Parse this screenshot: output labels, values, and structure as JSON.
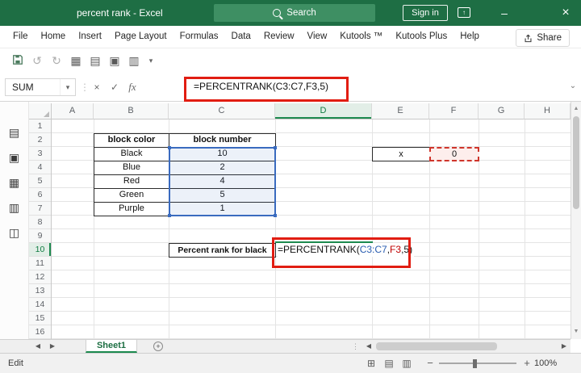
{
  "titlebar": {
    "title": "percent rank - Excel",
    "search_label": "Search",
    "signin_label": "Sign in"
  },
  "menu": {
    "items": [
      "File",
      "Home",
      "Insert",
      "Page Layout",
      "Formulas",
      "Data",
      "Review",
      "View",
      "Kutools ™",
      "Kutools Plus",
      "Help"
    ],
    "share_label": "Share"
  },
  "formula_bar": {
    "name_box": "SUM",
    "formula": "=PERCENTRANK(C3:C7,F3,5)"
  },
  "cell_formula": {
    "p1": "=PERCENTRANK(",
    "ref1": "C3:C7",
    "p2": ",",
    "ref2": "F3",
    "p3": ",5)"
  },
  "grid": {
    "columns": [
      "A",
      "B",
      "C",
      "D",
      "E",
      "F",
      "G",
      "H"
    ],
    "rows": [
      "1",
      "2",
      "3",
      "4",
      "5",
      "6",
      "7",
      "8",
      "9",
      "10",
      "11",
      "12",
      "13",
      "14",
      "15",
      "16"
    ]
  },
  "sheet": {
    "table": {
      "headers": [
        "block color",
        "block number"
      ],
      "rows": [
        [
          "Black",
          "10"
        ],
        [
          "Blue",
          "2"
        ],
        [
          "Red",
          "4"
        ],
        [
          "Green",
          "5"
        ],
        [
          "Purple",
          "1"
        ]
      ]
    },
    "x_label": "x",
    "x_value": "0",
    "result_label": "Percent rank for black"
  },
  "sheet_tabs": {
    "active": "Sheet1"
  },
  "status": {
    "mode": "Edit",
    "zoom": "100%"
  },
  "colors": {
    "accent_green": "#1e6e44",
    "annotation_red": "#e11d12",
    "ref_blue": "#2a5db0",
    "ref_red": "#c00000",
    "range_blue": "#3a6bbf"
  },
  "icons": {
    "minimize": "–",
    "close": "×",
    "up_small": "↑",
    "cancel": "×",
    "enter": "✓",
    "fx": "fx",
    "dropdown": "▾",
    "dots": "⋮",
    "collapse": "⌄",
    "undo": "↺",
    "redo": "↻",
    "qat": [
      "▦",
      "▤",
      "▣",
      "▥"
    ],
    "sidebar": [
      "▤",
      "▣",
      "▦",
      "▥",
      "◫"
    ],
    "left": "◀",
    "right": "▶",
    "up": "▲",
    "down": "▼",
    "add": "+",
    "view_normal": "⊞",
    "view_layout": "▤",
    "view_break": "▥",
    "zoom_minus": "−",
    "zoom_plus": "+"
  }
}
